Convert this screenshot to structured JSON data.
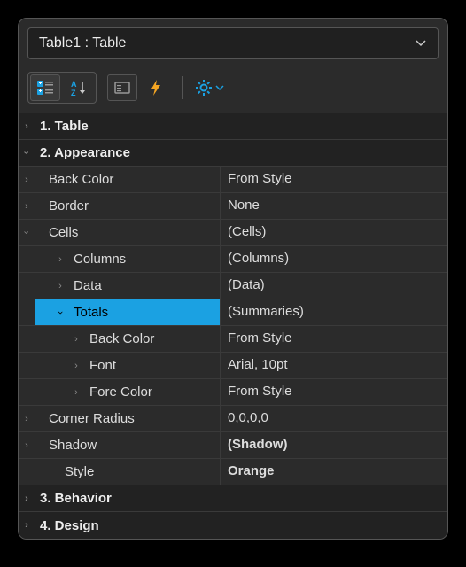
{
  "selector": {
    "text": "Table1 : Table"
  },
  "sections": {
    "table": "1. Table",
    "appearance": "2. Appearance",
    "behavior": "3. Behavior",
    "design": "4. Design"
  },
  "props": {
    "backColor": {
      "label": "Back Color",
      "value": "From Style"
    },
    "border": {
      "label": "Border",
      "value": "None"
    },
    "cells": {
      "label": "Cells",
      "value": "(Cells)"
    },
    "columns": {
      "label": "Columns",
      "value": "(Columns)"
    },
    "data": {
      "label": "Data",
      "value": "(Data)"
    },
    "totals": {
      "label": "Totals",
      "value": "(Summaries)"
    },
    "totalsBackColor": {
      "label": "Back Color",
      "value": "From Style"
    },
    "totalsFont": {
      "label": "Font",
      "value": "Arial, 10pt"
    },
    "totalsForeColor": {
      "label": "Fore Color",
      "value": "From Style"
    },
    "cornerRadius": {
      "label": "Corner Radius",
      "value": "0,0,0,0"
    },
    "shadow": {
      "label": "Shadow",
      "value": "(Shadow)"
    },
    "style": {
      "label": "Style",
      "value": "Orange"
    }
  }
}
